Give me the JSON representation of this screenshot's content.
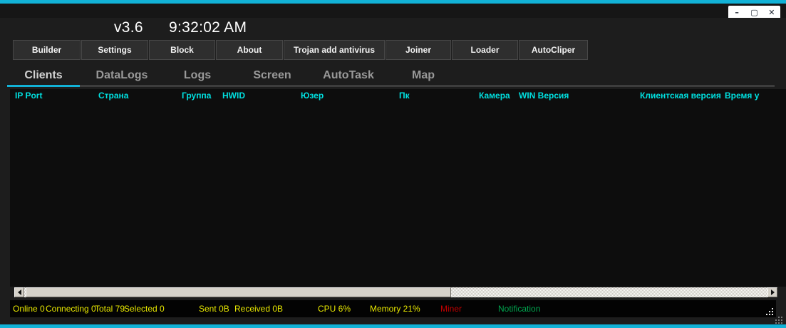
{
  "window": {
    "version": "v3.6",
    "clock": "9:32:02 AM",
    "controls": {
      "minimize": "–",
      "maximize": "▢",
      "close": "✕"
    },
    "colors": {
      "accent_cyan": "#12b2d7",
      "table_header_cyan": "#00e0e0",
      "status_yellow": "#e8e800",
      "miner_red": "#c40000",
      "notification_green": "#00a44e"
    }
  },
  "toolbar": {
    "buttons": [
      "Builder",
      "Settings",
      "Block",
      "About",
      "Trojan add antivirus",
      "Joiner",
      "Loader",
      "AutoCliper"
    ]
  },
  "tabs": {
    "items": [
      {
        "label": "Clients",
        "active": true
      },
      {
        "label": "DataLogs",
        "active": false
      },
      {
        "label": "Logs",
        "active": false
      },
      {
        "label": "Screen",
        "active": false
      },
      {
        "label": "AutoTask",
        "active": false
      },
      {
        "label": "Map",
        "active": false
      }
    ]
  },
  "table": {
    "columns": [
      "IP Port",
      "Страна",
      "Группа",
      "HWID",
      "Юзер",
      "Пк",
      "Камера",
      "WIN Версия",
      "Клиентская версия",
      "Время у"
    ],
    "rows": []
  },
  "statusbar": {
    "online": "Online 0",
    "connecting": "Connecting 0",
    "total": "Total 79",
    "selected": "Selected 0",
    "sent": "Sent 0B",
    "received": "Received  0B",
    "cpu": "CPU 6%",
    "memory": "Memory 21%",
    "miner": "Miner",
    "notification": "Notification"
  }
}
